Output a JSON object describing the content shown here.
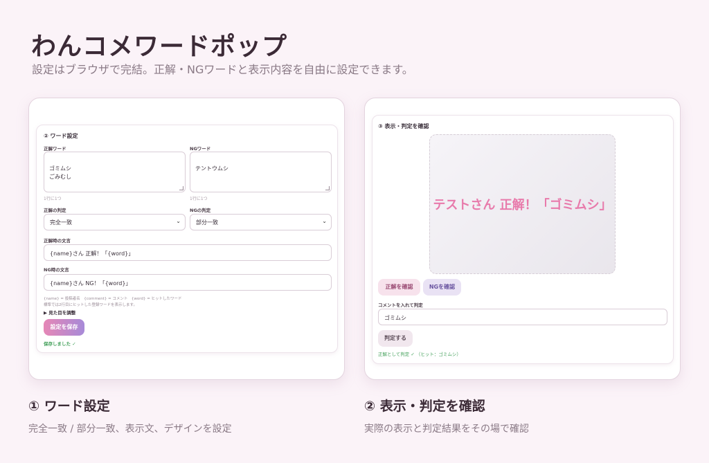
{
  "header": {
    "title": "わんコメワードポップ",
    "subtitle": "設定はブラウザで完結。正解・NGワードと表示内容を自由に設定できます。"
  },
  "word_settings": {
    "panel_title": "② ワード設定",
    "correct_word_label": "正解ワード",
    "correct_word_value": "ゴミムシ\nごみむし",
    "correct_hint": "1行に1つ",
    "ng_word_label": "NGワード",
    "ng_word_value": "テントウムシ",
    "ng_hint": "1行に1つ",
    "correct_judge_label": "正解の判定",
    "correct_judge_value": "完全一致",
    "ng_judge_label": "NGの判定",
    "ng_judge_value": "部分一致",
    "correct_msg_label": "正解時の文言",
    "correct_msg_value": "{name}さん 正解！「{word}」",
    "ng_msg_label": "NG時の文言",
    "ng_msg_value": "{name}さん NG！「{word}」",
    "help_line1": "{name} = 投稿者名　{comment} = コメント　{word} = ヒットしたワード",
    "help_line2": "標準では2行目にヒットした登録ワードを表示します。",
    "appearance_toggle": "▶ 見た目を調整",
    "save_button": "設定を保存",
    "saved_status": "保存しました ✓"
  },
  "preview_panel": {
    "panel_title": "③ 表示・判定を確認",
    "preview_text": "テストさん 正解！「ゴミムシ」",
    "check_correct_button": "正解を確認",
    "check_ng_button": "NGを確認",
    "comment_label": "コメントを入れて判定",
    "comment_value": "ゴミムシ",
    "judge_button": "判定する",
    "result_text": "正解として判定 ✓ （ヒット：ゴミムシ）"
  },
  "captions": {
    "left_title": "① ワード設定",
    "left_sub": "完全一致 / 部分一致、表示文、デザインを設定",
    "right_title": "② 表示・判定を確認",
    "right_sub": "実際の表示と判定結果をその場で確認"
  },
  "colors": {
    "background": "#fbf3f8",
    "accent_pink": "#e87aab",
    "accent_purple": "#a78ad8",
    "success": "#43a05a"
  }
}
